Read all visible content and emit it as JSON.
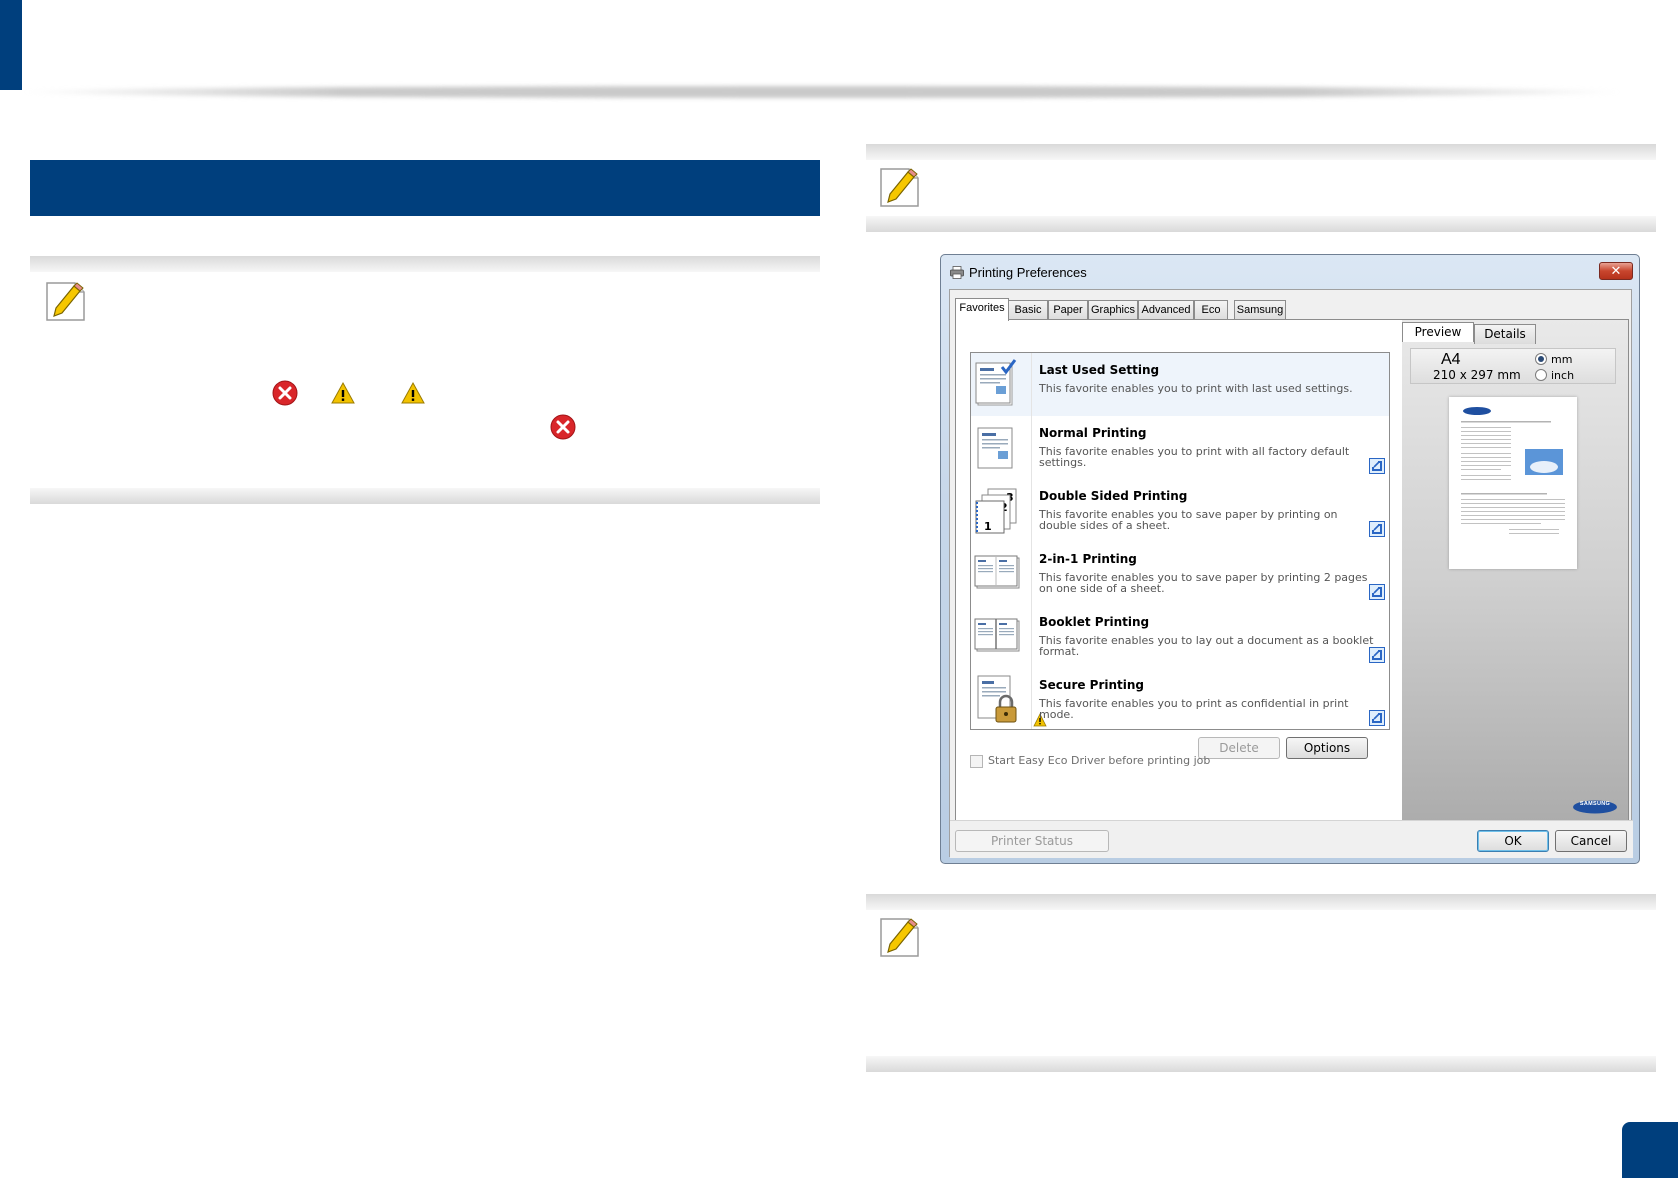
{
  "dialog": {
    "title": "Printing Preferences",
    "close_label": "✕",
    "tabs": [
      {
        "label": "Favorites",
        "active": true
      },
      {
        "label": "Basic",
        "active": false
      },
      {
        "label": "Paper",
        "active": false
      },
      {
        "label": "Graphics",
        "active": false
      },
      {
        "label": "Advanced",
        "active": false
      },
      {
        "label": "Eco",
        "active": false
      },
      {
        "label": "Samsung",
        "active": false
      }
    ],
    "favorites": [
      {
        "title": "Last Used Setting",
        "description": "This favorite enables you to print with last used settings.",
        "icon": "document-check-icon",
        "selected": true
      },
      {
        "title": "Normal Printing",
        "description": "This favorite enables you to print with all factory default settings.",
        "icon": "document-icon"
      },
      {
        "title": "Double Sided Printing",
        "description": "This favorite enables you to save paper by printing on double sides of a sheet.",
        "icon": "duplex-icon"
      },
      {
        "title": "2-in-1 Printing",
        "description": "This favorite enables you to save paper by printing 2 pages on one side of a sheet.",
        "icon": "two-up-icon"
      },
      {
        "title": "Booklet Printing",
        "description": "This favorite enables you to lay out a document as a booklet format.",
        "icon": "booklet-icon"
      },
      {
        "title": "Secure Printing",
        "description": "This favorite enables you to print as confidential in print mode.",
        "icon": "lock-document-icon",
        "warning": true
      }
    ],
    "delete_label": "Delete",
    "options_label": "Options",
    "eco_checkbox_label": "Start Easy Eco Driver before printing job",
    "preview_tabs": {
      "preview": "Preview",
      "details": "Details"
    },
    "paper_size": "A4",
    "paper_dimensions": "210 x 297 mm",
    "unit_options": {
      "mm": "mm",
      "inch": "inch",
      "selected": "mm"
    },
    "printer_status_label": "Printer Status",
    "ok_label": "OK",
    "cancel_label": "Cancel",
    "brand": "SAMSUNG"
  },
  "colors": {
    "brand_blue": "#003f7d",
    "error_red": "#d9262a",
    "warning_yellow": "#f2c200"
  }
}
